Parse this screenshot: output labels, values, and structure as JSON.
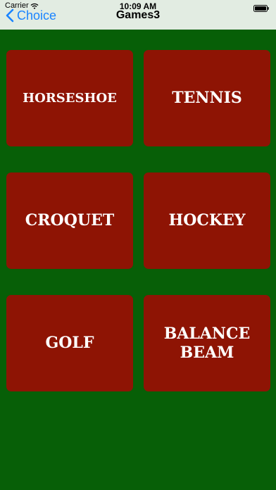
{
  "status_bar": {
    "carrier": "Carrier",
    "time": "10:09 AM",
    "wifi_icon": "wifi-icon",
    "battery_icon": "battery-icon"
  },
  "nav": {
    "back_label": "Choice",
    "back_icon": "chevron-left-icon",
    "title": "Games3"
  },
  "colors": {
    "background": "#075f07",
    "nav_background": "#e2ece2",
    "tile": "#8e1404",
    "tile_text": "#ffffff",
    "accent": "#1a84ff"
  },
  "tiles": [
    {
      "label": "HORSESHOE"
    },
    {
      "label": "TENNIS"
    },
    {
      "label": "CROQUET"
    },
    {
      "label": "HOCKEY"
    },
    {
      "label": "GOLF"
    },
    {
      "label": "BALANCE\nBEAM"
    }
  ]
}
